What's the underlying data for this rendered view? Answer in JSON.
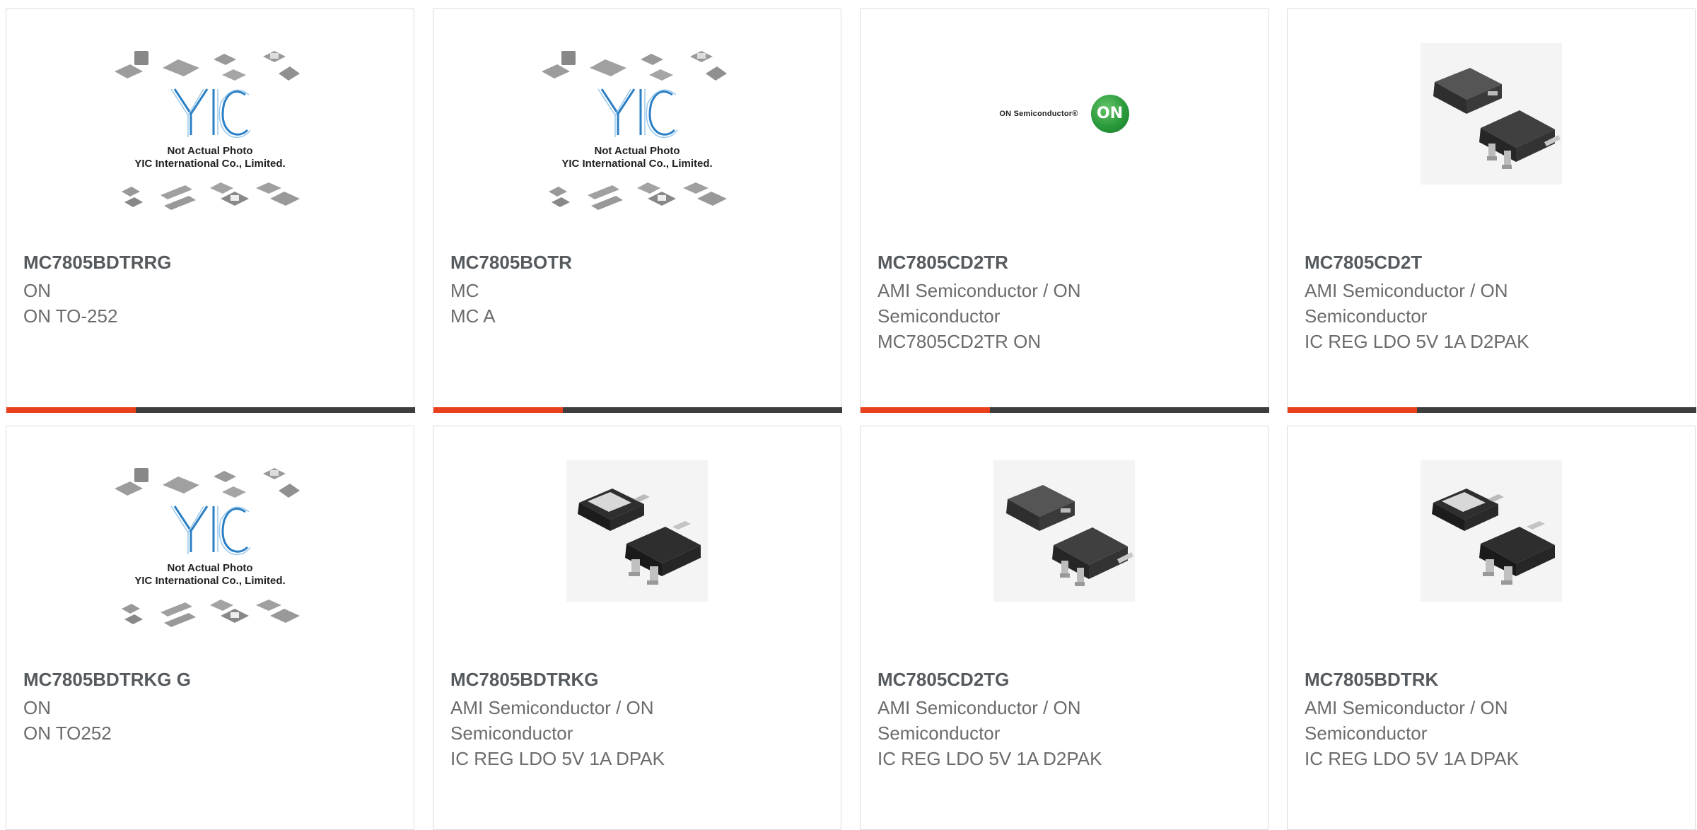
{
  "colors": {
    "accent": "#e8401c",
    "bar": "#3d3d3d",
    "title": "#555a5e",
    "text": "#6b6b6b"
  },
  "placeholder": {
    "line1": "Not Actual Photo",
    "line2": "YIC International Co., Limited.",
    "logo": "YIC"
  },
  "onsemi_logo": {
    "text": "ON Semiconductor®",
    "badge": "ON"
  },
  "products": [
    {
      "part": "MC7805BDTRRG",
      "lines": [
        "ON",
        "ON TO-252"
      ],
      "image": "yic-placeholder"
    },
    {
      "part": "MC7805BOTR",
      "lines": [
        "MC",
        "MC A"
      ],
      "image": "yic-placeholder"
    },
    {
      "part": "MC7805CD2TR",
      "lines": [
        "AMI Semiconductor / ON",
        "Semiconductor",
        "MC7805CD2TR ON"
      ],
      "image": "onsemi-logo"
    },
    {
      "part": "MC7805CD2T",
      "lines": [
        "AMI Semiconductor / ON",
        "Semiconductor",
        "IC REG LDO 5V 1A D2PAK"
      ],
      "image": "d2pak-chip"
    },
    {
      "part": "MC7805BDTRKG G",
      "lines": [
        "ON",
        "ON TO252"
      ],
      "image": "yic-placeholder"
    },
    {
      "part": "MC7805BDTRKG",
      "lines": [
        "AMI Semiconductor / ON",
        "Semiconductor",
        "IC REG LDO 5V 1A DPAK"
      ],
      "image": "dpak-chip"
    },
    {
      "part": "MC7805CD2TG",
      "lines": [
        "AMI Semiconductor / ON",
        "Semiconductor",
        "IC REG LDO 5V 1A D2PAK"
      ],
      "image": "d2pak-chip"
    },
    {
      "part": "MC7805BDTRK",
      "lines": [
        "AMI Semiconductor / ON",
        "Semiconductor",
        "IC REG LDO 5V 1A DPAK"
      ],
      "image": "dpak-chip"
    }
  ]
}
